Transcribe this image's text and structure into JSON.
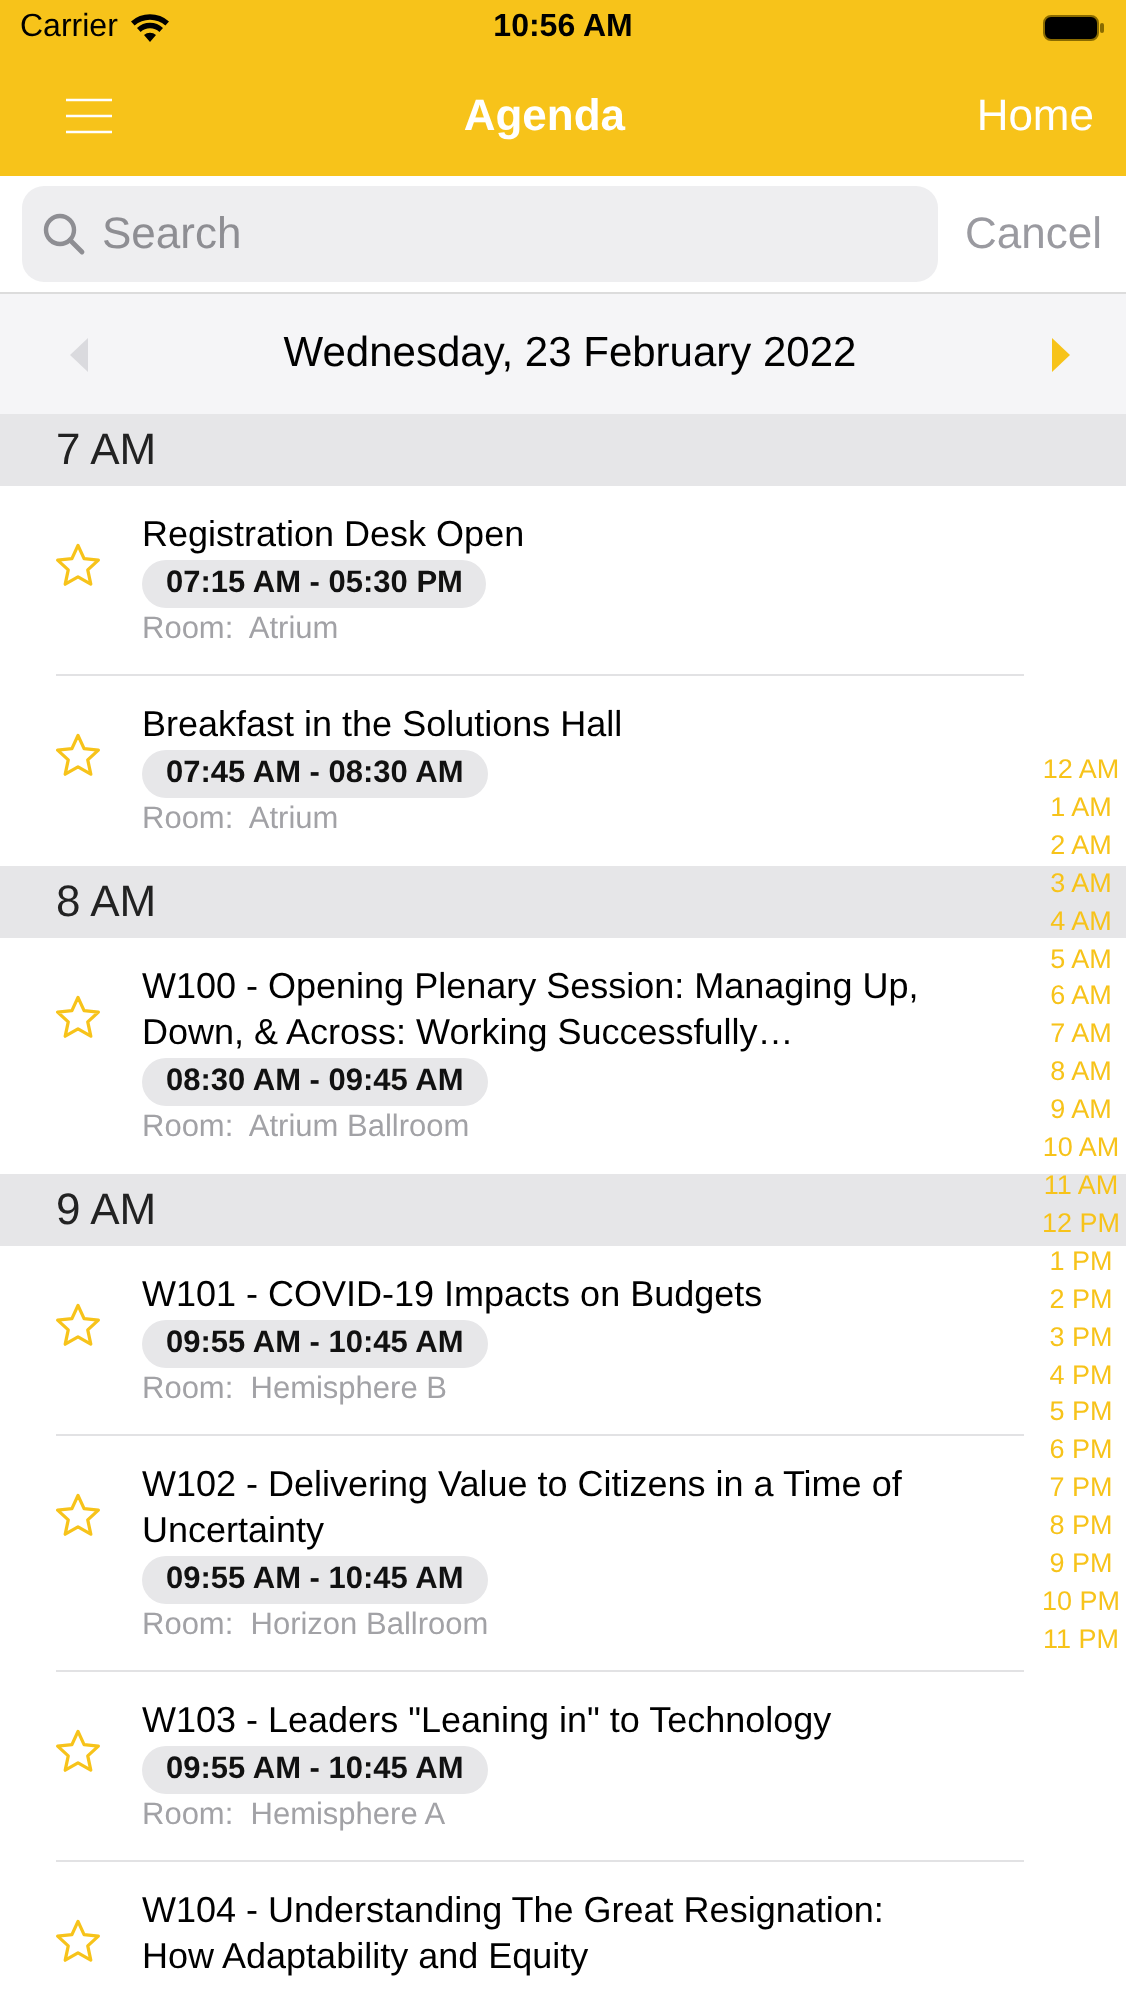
{
  "status_bar": {
    "carrier": "Carrier",
    "time": "10:56 AM"
  },
  "nav_bar": {
    "title": "Agenda",
    "right_button": "Home"
  },
  "search": {
    "placeholder": "Search",
    "cancel": "Cancel",
    "cancel_disabled": true
  },
  "date_nav": {
    "date": "Wednesday, 23 February 2022",
    "prev_disabled": true,
    "next_disabled": false
  },
  "sections": [
    {
      "header": "7 AM",
      "items": [
        {
          "title": "Registration Desk Open",
          "time": "07:15 AM - 05:30 PM",
          "room_label": "Room:",
          "room": "Atrium",
          "favorite": false
        },
        {
          "title": "Breakfast in the Solutions Hall",
          "time": "07:45 AM - 08:30 AM",
          "room_label": "Room:",
          "room": "Atrium",
          "favorite": false
        }
      ]
    },
    {
      "header": "8 AM",
      "items": [
        {
          "title": "W100 - Opening Plenary Session: Managing Up, Down, & Across: Working Successfully…",
          "time": "08:30 AM - 09:45 AM",
          "room_label": "Room:",
          "room": "Atrium Ballroom",
          "favorite": false
        }
      ]
    },
    {
      "header": "9 AM",
      "items": [
        {
          "title": "W101 - COVID-19 Impacts on Budgets",
          "time": "09:55 AM - 10:45 AM",
          "room_label": "Room:",
          "room": "Hemisphere B",
          "favorite": false
        },
        {
          "title": "W102 -  Delivering Value to Citizens in a Time of Uncertainty",
          "time": "09:55 AM - 10:45 AM",
          "room_label": "Room:",
          "room": "Horizon Ballroom",
          "favorite": false
        },
        {
          "title": "W103 - Leaders \"Leaning in\" to Technology",
          "time": "09:55 AM - 10:45 AM",
          "room_label": "Room:",
          "room": "Hemisphere A",
          "favorite": false
        },
        {
          "title": "W104 - Understanding The Great Resignation: How Adaptability and Equity",
          "favorite": false
        }
      ]
    }
  ],
  "hour_index": [
    "12 AM",
    "1 AM",
    "2 AM",
    "3 AM",
    "4 AM",
    "5 AM",
    "6 AM",
    "7 AM",
    "8 AM",
    "9 AM",
    "10 AM",
    "11 AM",
    "12 PM",
    "1 PM",
    "2 PM",
    "3 PM",
    "4 PM",
    "5 PM",
    "6 PM",
    "7 PM",
    "8 PM",
    "9 PM",
    "10 PM",
    "11 PM"
  ]
}
